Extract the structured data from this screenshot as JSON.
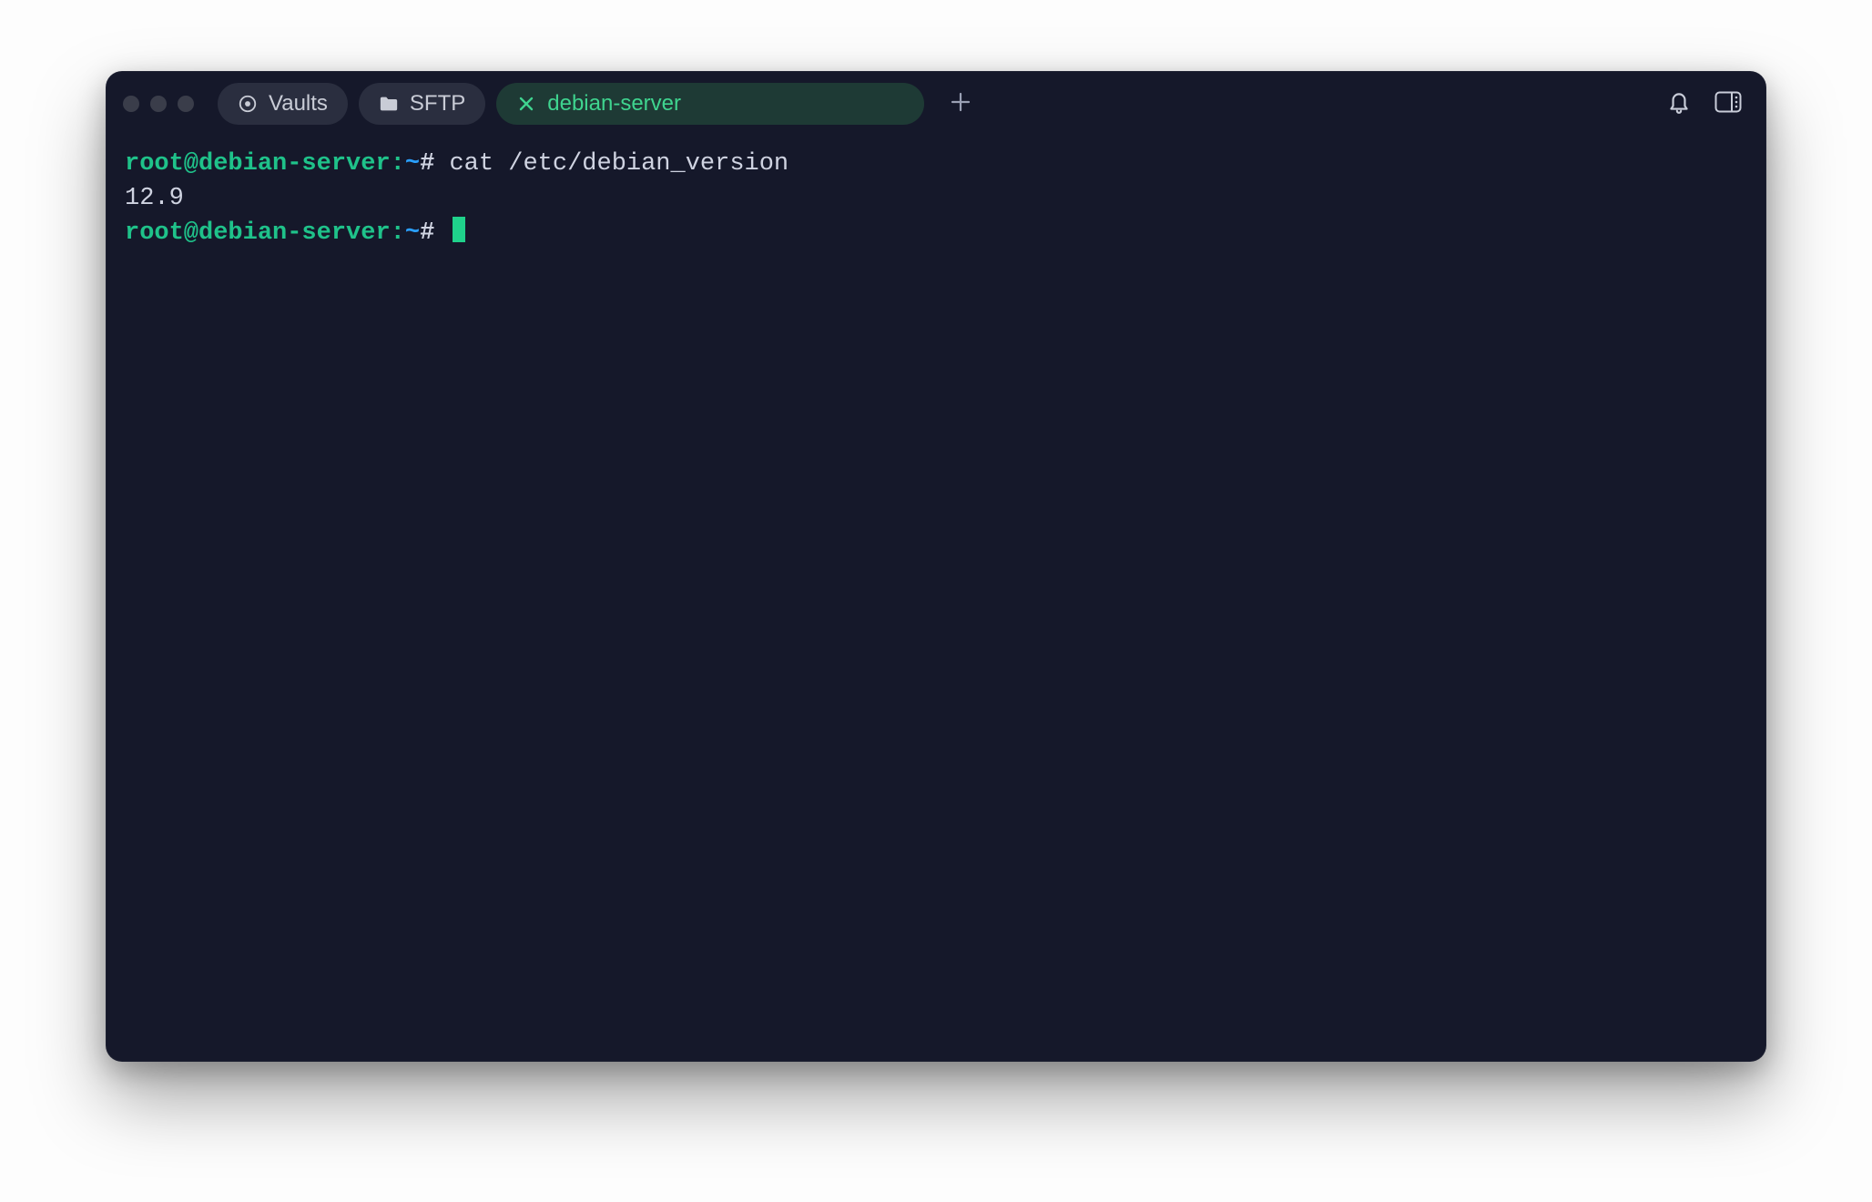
{
  "tabs": {
    "vaults": {
      "label": "Vaults"
    },
    "sftp": {
      "label": "SFTP"
    },
    "active": {
      "label": "debian-server"
    }
  },
  "terminal": {
    "prompt_user_host": "root@debian-server:",
    "prompt_path": "~",
    "prompt_symbol": "#",
    "line1_command": "cat /etc/debian_version",
    "line2_output": "12.9"
  }
}
